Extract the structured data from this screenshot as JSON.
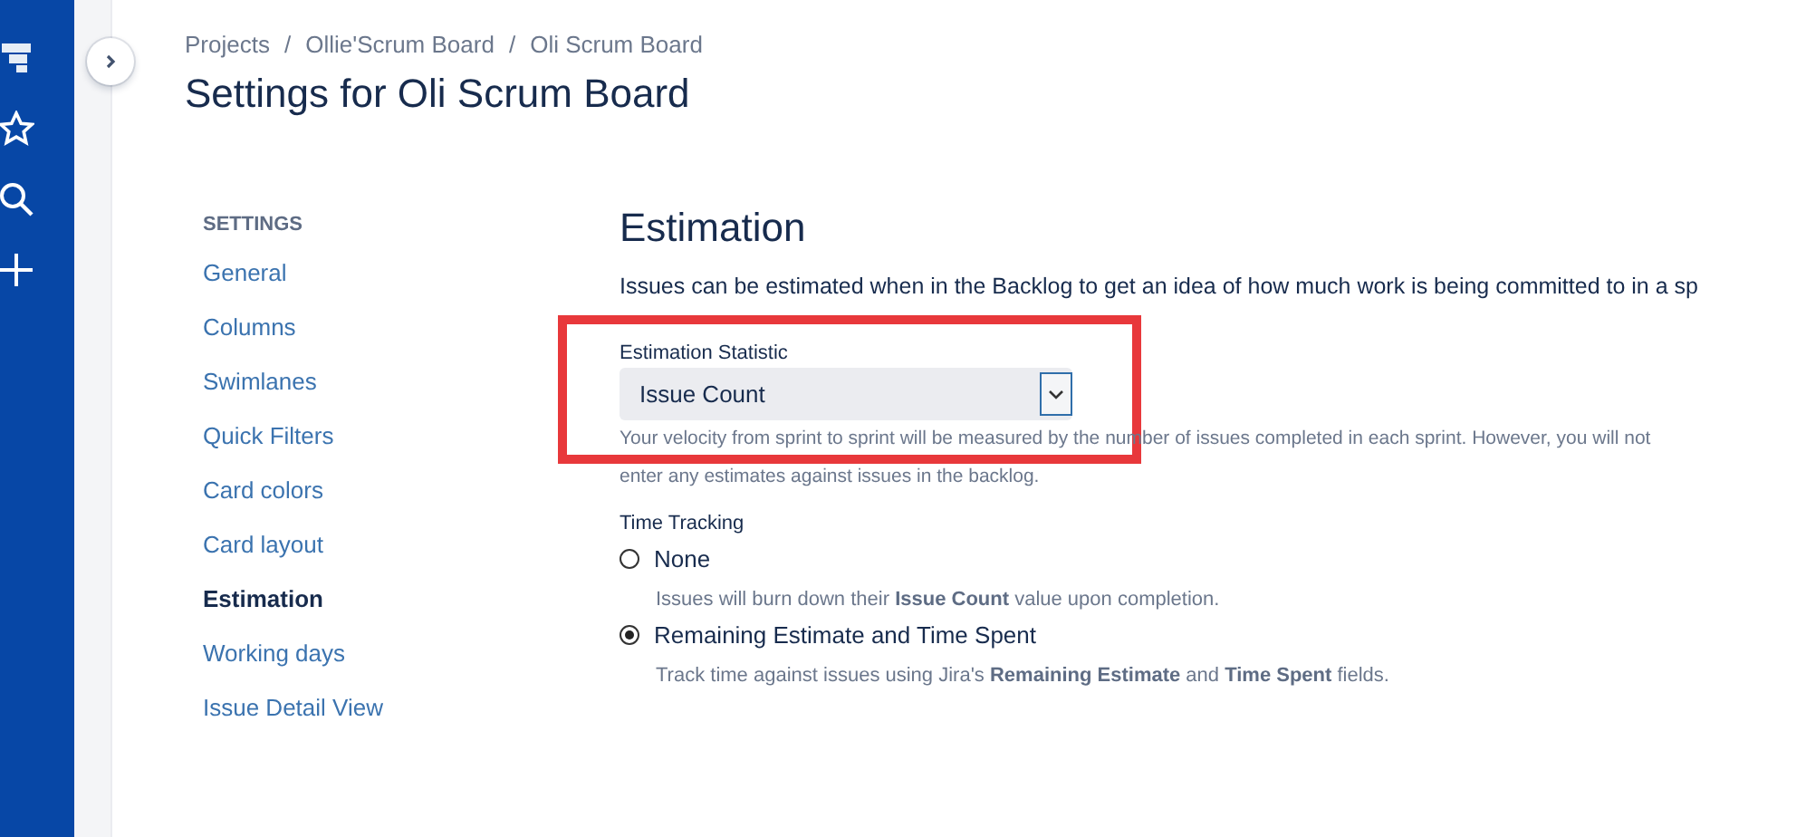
{
  "breadcrumbs": [
    "Projects",
    "Ollie'Scrum Board",
    "Oli Scrum Board"
  ],
  "breadcrumb_separator": "/",
  "title": "Settings for Oli Scrum Board",
  "sidebar": {
    "heading": "SETTINGS",
    "items": [
      {
        "label": "General",
        "selected": false
      },
      {
        "label": "Columns",
        "selected": false
      },
      {
        "label": "Swimlanes",
        "selected": false
      },
      {
        "label": "Quick Filters",
        "selected": false
      },
      {
        "label": "Card colors",
        "selected": false
      },
      {
        "label": "Card layout",
        "selected": false
      },
      {
        "label": "Estimation",
        "selected": true
      },
      {
        "label": "Working days",
        "selected": false
      },
      {
        "label": "Issue Detail View",
        "selected": false
      }
    ]
  },
  "section": {
    "heading": "Estimation",
    "description": "Issues can be estimated when in the Backlog to get an idea of how much work is being committed to in a sp",
    "statistic": {
      "label": "Estimation Statistic",
      "value": "Issue Count",
      "help_lines": [
        "Your velocity from sprint to sprint will be measured by the number of issues completed in each sprint. However, you will not",
        "enter any estimates against issues in the backlog."
      ]
    },
    "time_tracking": {
      "label": "Time Tracking",
      "options": [
        {
          "label": "None",
          "selected": false,
          "help": "Issues will burn down their **Issue Count** value upon completion."
        },
        {
          "label": "Remaining Estimate and Time Spent",
          "selected": true,
          "help": "Track time against issues using Jira's **Remaining Estimate** and **Time Spent** fields."
        }
      ]
    }
  }
}
